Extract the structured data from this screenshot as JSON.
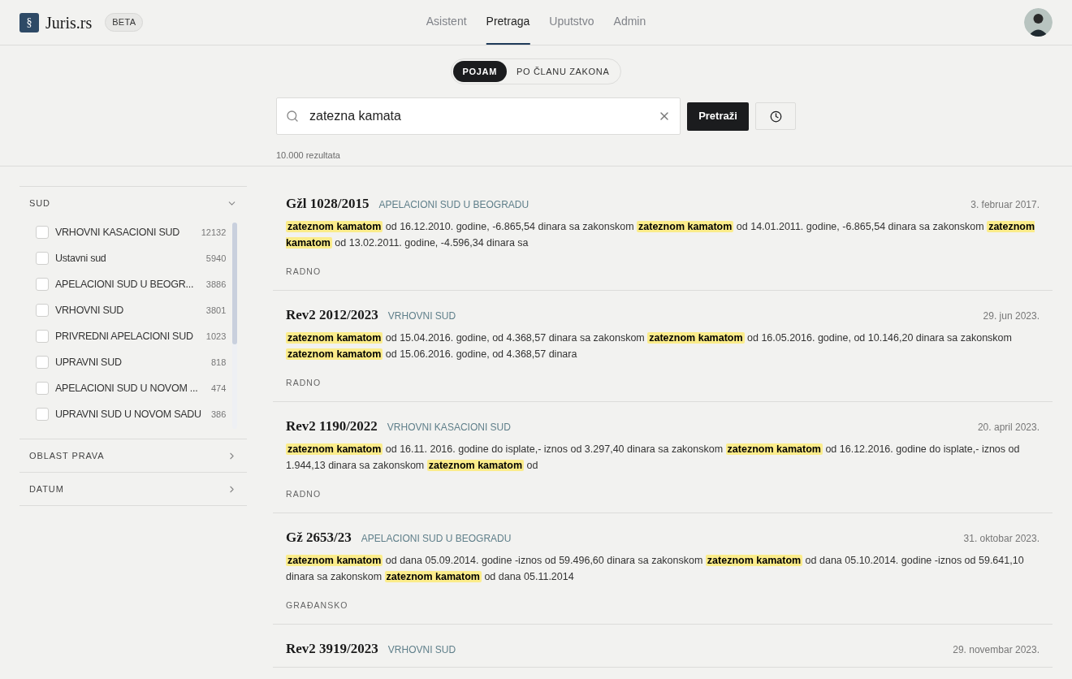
{
  "header": {
    "logo_mark": "§",
    "brand": "Juris.rs",
    "badge": "BETA",
    "nav": [
      {
        "label": "Asistent",
        "selected": false
      },
      {
        "label": "Pretraga",
        "selected": true
      },
      {
        "label": "Uputstvo",
        "selected": false
      },
      {
        "label": "Admin",
        "selected": false
      }
    ]
  },
  "search": {
    "modes": [
      {
        "label": "POJAM",
        "selected": true
      },
      {
        "label": "PO ČLANU ZAKONA",
        "selected": false
      }
    ],
    "value": "zatezna kamata",
    "submit": "Pretraži",
    "result_count": "10.000 rezultata"
  },
  "filters": [
    {
      "title": "SUD",
      "expanded": true,
      "options": [
        {
          "label": "VRHOVNI KASACIONI SUD",
          "count": "12132",
          "checked": false
        },
        {
          "label": "Ustavni sud",
          "count": "5940",
          "checked": false
        },
        {
          "label": "APELACIONI SUD U BEOGR...",
          "count": "3886",
          "checked": false
        },
        {
          "label": "VRHOVNI SUD",
          "count": "3801",
          "checked": false
        },
        {
          "label": "PRIVREDNI APELACIONI SUD",
          "count": "1023",
          "checked": false
        },
        {
          "label": "UPRAVNI SUD",
          "count": "818",
          "checked": false
        },
        {
          "label": "APELACIONI SUD U NOVOM ...",
          "count": "474",
          "checked": false
        },
        {
          "label": "UPRAVNI SUD U NOVOM SADU",
          "count": "386",
          "checked": false
        }
      ]
    },
    {
      "title": "OBLAST PRAVA",
      "expanded": false
    },
    {
      "title": "DATUM",
      "expanded": false
    }
  ],
  "results": [
    {
      "case": "Gžl 1028/2015",
      "court": "APELACIONI SUD U BEOGRADU",
      "date": "3. februar 2017.",
      "snippet": [
        {
          "text": "zateznom kamatom",
          "highlighted": true
        },
        {
          "text": " od 16.12.2010. godine, -6.865,54 dinara sa zakonskom ",
          "highlighted": false
        },
        {
          "text": "zateznom kamatom",
          "highlighted": true
        },
        {
          "text": " od 14.01.2011. godine, -6.865,54 dinara sa zakonskom ",
          "highlighted": false
        },
        {
          "text": "zateznom kamatom",
          "highlighted": true
        },
        {
          "text": " od 13.02.2011. godine, -4.596,34 dinara sa",
          "highlighted": false
        }
      ],
      "area": "RADNO"
    },
    {
      "case": "Rev2 2012/2023",
      "court": "VRHOVNI SUD",
      "date": "29. jun 2023.",
      "snippet": [
        {
          "text": "zateznom kamatom",
          "highlighted": true
        },
        {
          "text": " od 15.04.2016. godine, od 4.368,57 dinara sa zakonskom ",
          "highlighted": false
        },
        {
          "text": "zateznom kamatom",
          "highlighted": true
        },
        {
          "text": " od 16.05.2016. godine, od 10.146,20 dinara sa zakonskom ",
          "highlighted": false
        },
        {
          "text": "zateznom kamatom",
          "highlighted": true
        },
        {
          "text": " od 15.06.2016. godine, od 4.368,57 dinara",
          "highlighted": false
        }
      ],
      "area": "RADNO"
    },
    {
      "case": "Rev2 1190/2022",
      "court": "VRHOVNI KASACIONI SUD",
      "date": "20. april 2023.",
      "snippet": [
        {
          "text": "zateznom kamatom",
          "highlighted": true
        },
        {
          "text": " od 16.11. 2016. godine do isplate,- iznos od 3.297,40 dinara sa zakonskom ",
          "highlighted": false
        },
        {
          "text": "zateznom kamatom",
          "highlighted": true
        },
        {
          "text": " od 16.12.2016. godine do isplate,- iznos od 1.944,13 dinara sa zakonskom ",
          "highlighted": false
        },
        {
          "text": "zateznom kamatom",
          "highlighted": true
        },
        {
          "text": " od",
          "highlighted": false
        }
      ],
      "area": "RADNO"
    },
    {
      "case": "Gž 2653/23",
      "court": "APELACIONI SUD U BEOGRADU",
      "date": "31. oktobar 2023.",
      "snippet": [
        {
          "text": "zateznom kamatom",
          "highlighted": true
        },
        {
          "text": " od dana 05.09.2014. godine -iznos od 59.496,60 dinara sa zakonskom ",
          "highlighted": false
        },
        {
          "text": "zateznom kamatom",
          "highlighted": true
        },
        {
          "text": " od dana 05.10.2014. godine -iznos od 59.641,10 dinara sa zakonskom ",
          "highlighted": false
        },
        {
          "text": "zateznom kamatom",
          "highlighted": true
        },
        {
          "text": " od dana 05.11.2014",
          "highlighted": false
        }
      ],
      "area": "GRAĐANSKO"
    },
    {
      "case": "Rev2 3919/2023",
      "court": "VRHOVNI SUD",
      "date": "29. novembar 2023."
    }
  ]
}
